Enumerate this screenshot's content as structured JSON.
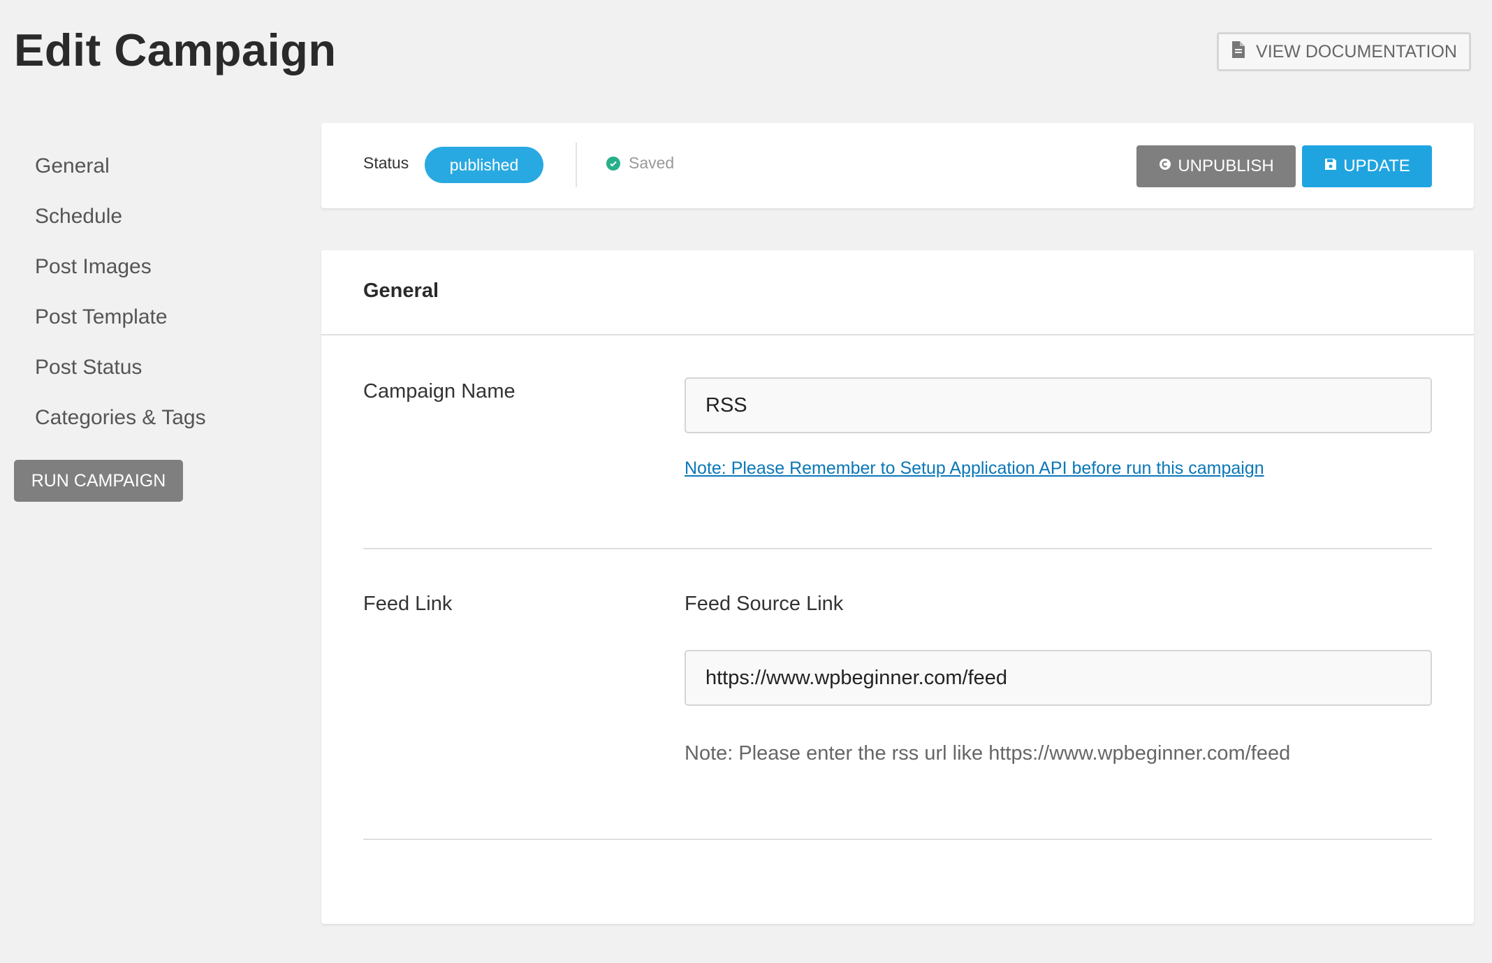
{
  "header": {
    "title": "Edit Campaign",
    "doc_button": {
      "label": "VIEW DOCUMENTATION",
      "icon": "document-icon"
    }
  },
  "sidebar": {
    "items": [
      {
        "label": "General"
      },
      {
        "label": "Schedule"
      },
      {
        "label": "Post Images"
      },
      {
        "label": "Post Template"
      },
      {
        "label": "Post Status"
      },
      {
        "label": "Categories & Tags"
      }
    ],
    "run_button": "RUN CAMPAIGN"
  },
  "status_bar": {
    "label": "Status",
    "status": "published",
    "saved": "Saved",
    "unpublish": {
      "label": "UNPUBLISH",
      "icon": "unpublish-icon"
    },
    "update": {
      "label": "UPDATE",
      "icon": "save-icon"
    }
  },
  "general": {
    "title": "General",
    "campaign_name_label": "Campaign Name",
    "campaign_name_value": "RSS",
    "api_note": "Note: Please Remember to Setup Application API before run this campaign",
    "feed_link_label": "Feed Link",
    "feed_source_label": "Feed Source Link",
    "feed_source_value": "https://www.wpbeginner.com/feed",
    "feed_note": "Note: Please enter the rss url like https://www.wpbeginner.com/feed"
  },
  "colors": {
    "accent": "#29a9e1",
    "update": "#1fa4e0",
    "muted_button": "#7f7f7f",
    "saved_check": "#27b08a",
    "link": "#0a77b8",
    "background": "#f1f1f1"
  }
}
